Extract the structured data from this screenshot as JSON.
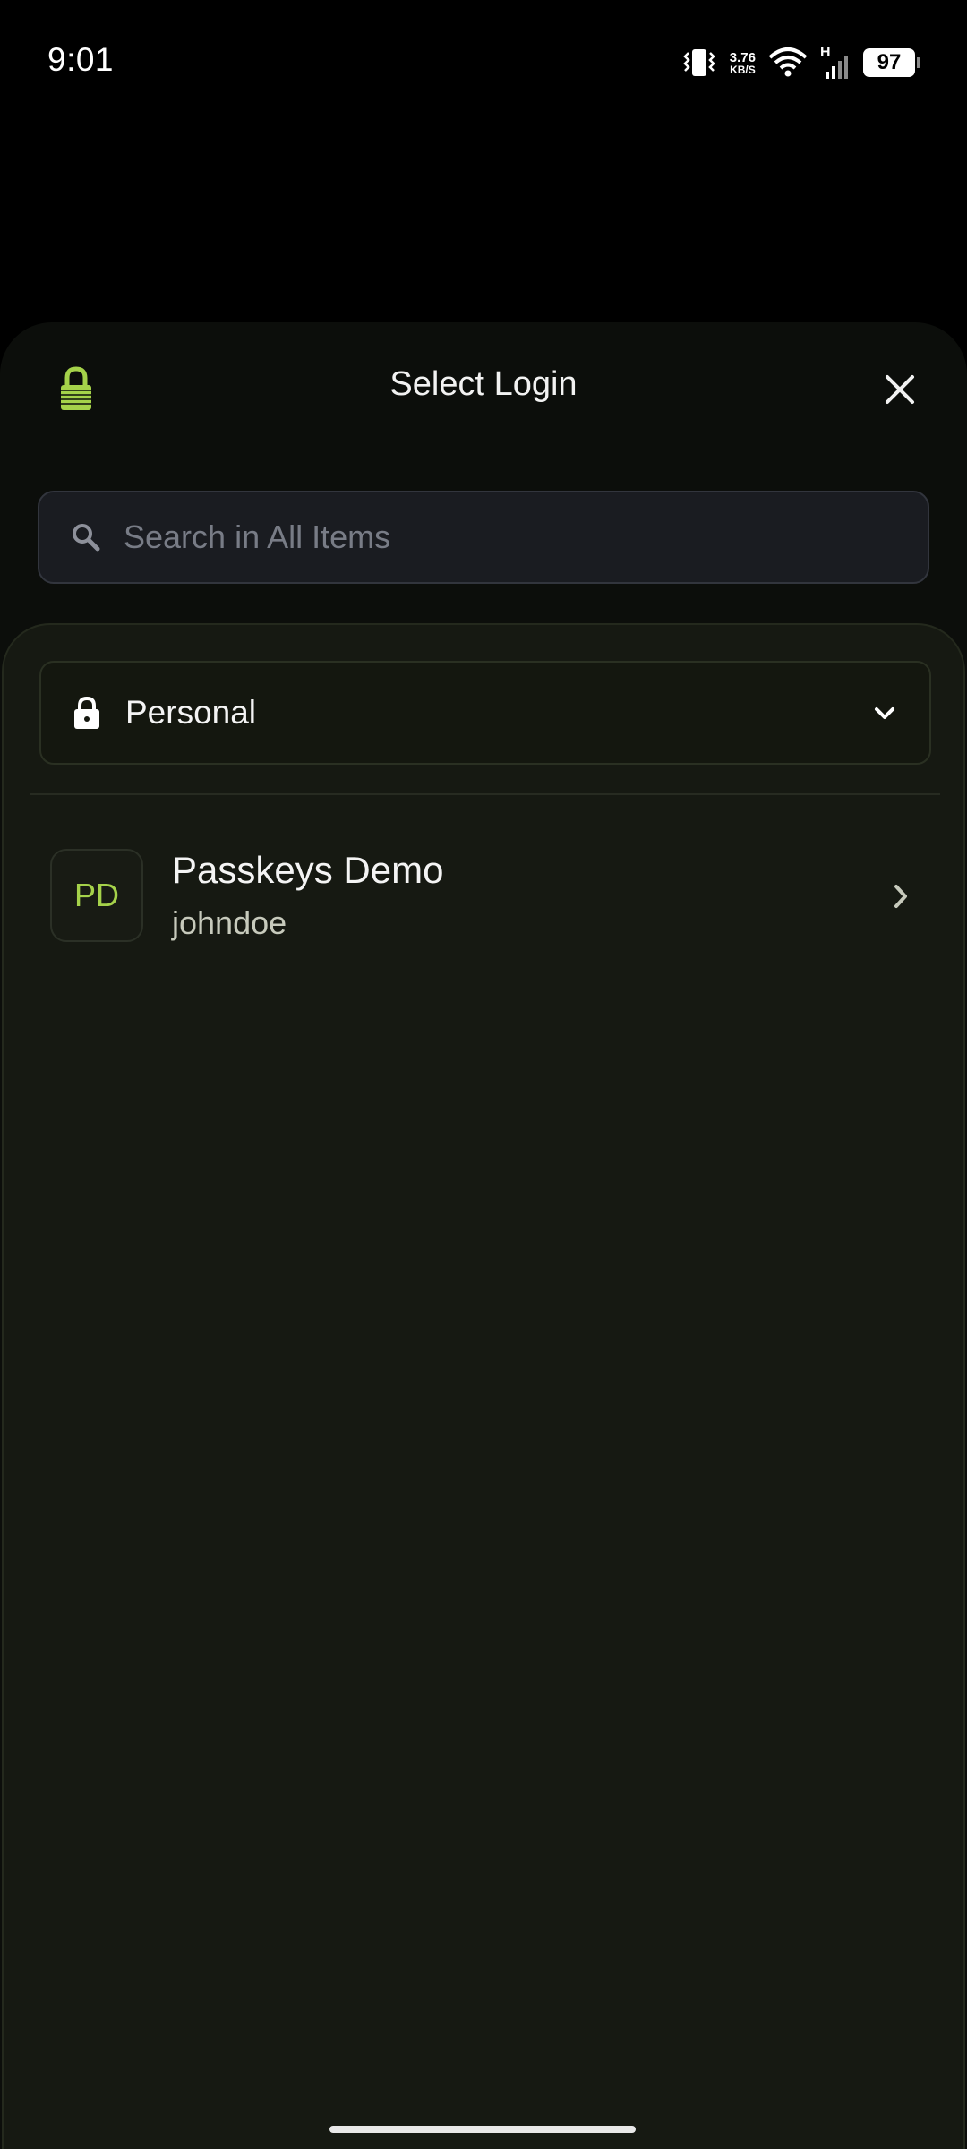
{
  "status_bar": {
    "time": "9:01",
    "net_speed_value": "3.76",
    "net_speed_unit": "KB/S",
    "network_type": "H",
    "battery": "97",
    "icons": [
      "vibrate-icon",
      "wifi-icon",
      "signal-icon",
      "battery-icon"
    ]
  },
  "sheet": {
    "title": "Select Login",
    "logo_icon": "lock-logo-icon",
    "close_icon": "close-icon",
    "accent_color": "#a5d24a"
  },
  "search": {
    "placeholder": "Search in All Items",
    "value": ""
  },
  "vault": {
    "selected": "Personal",
    "icon": "lock-icon",
    "dropdown_icon": "chevron-down-icon"
  },
  "items": [
    {
      "initials": "PD",
      "title": "Passkeys Demo",
      "subtitle": "johndoe",
      "chevron_icon": "chevron-right-icon"
    }
  ]
}
